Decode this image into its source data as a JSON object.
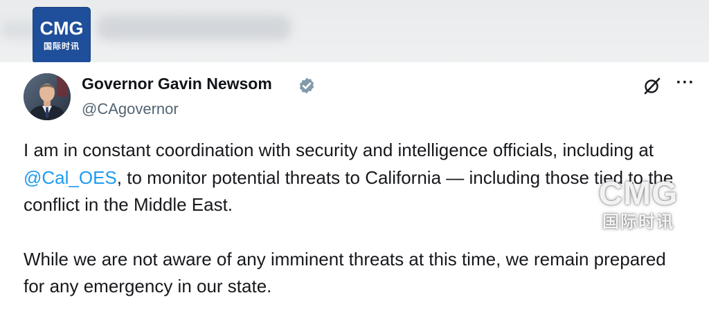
{
  "header": {
    "logo": {
      "letters": "CMG",
      "subtitle": "国际时讯",
      "color": "#1f4f9a"
    }
  },
  "tweet": {
    "author": {
      "display_name": "Governor Gavin Newsom",
      "handle": "@CAgovernor",
      "verified": true,
      "verified_badge_color": "#829aab"
    },
    "actions": {
      "grok_icon": "grok-icon",
      "more_icon": "more-options-icon",
      "more_glyph": "···"
    },
    "body": {
      "paragraph_1": {
        "before_mention": "I am in constant coordination with security and intelligence officials, including at ",
        "mention": "@Cal_OES",
        "after_mention": ", to monitor potential threats to California — including those tied to the conflict in the Middle East."
      },
      "paragraph_2": "While we are not aware of any imminent threats at this time, we remain prepared for any emergency in our state."
    },
    "colors": {
      "mention": "#1d9bf0",
      "text": "#16181c",
      "handle": "#536471"
    }
  },
  "watermark": {
    "letters": "CMG",
    "subtitle": "国际时讯"
  }
}
